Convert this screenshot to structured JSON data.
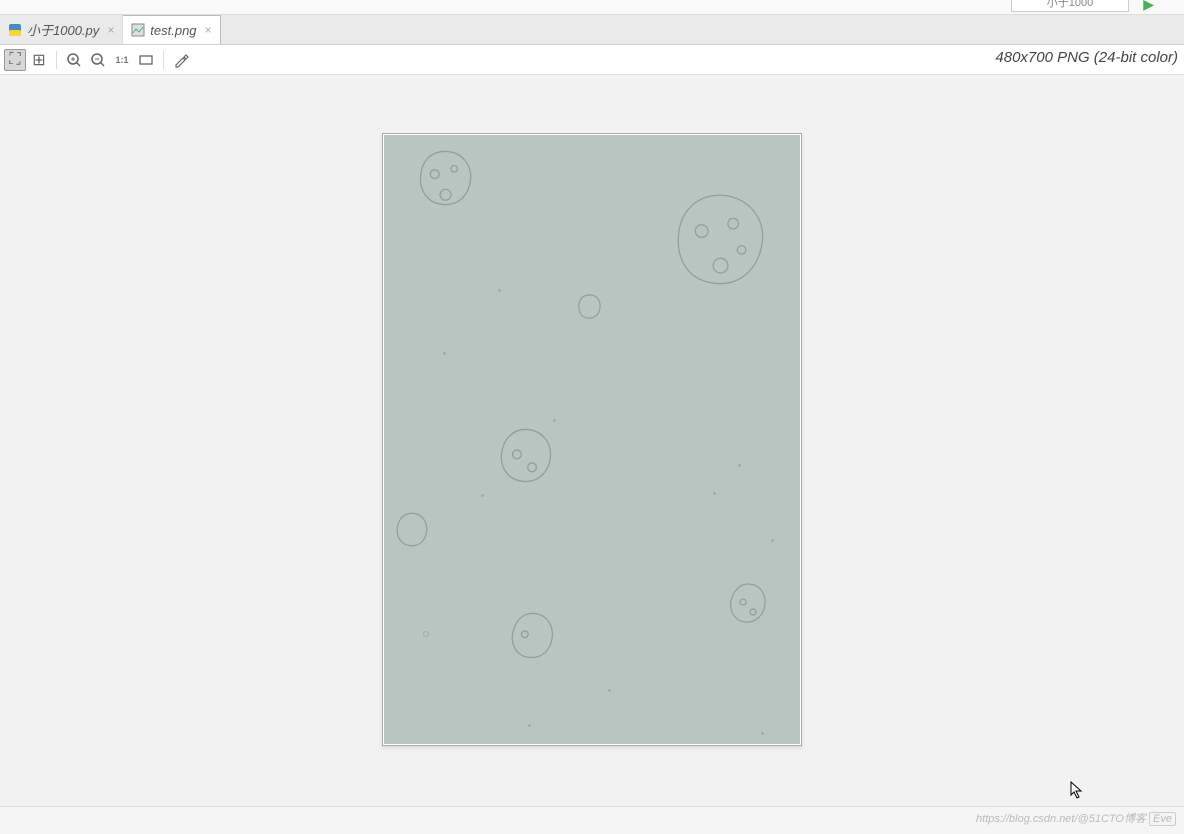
{
  "tabs": [
    {
      "label": "小于1000.py",
      "icon": "python-file-icon",
      "active": false
    },
    {
      "label": "test.png",
      "icon": "image-file-icon",
      "active": true
    }
  ],
  "toolbar": {
    "items": [
      {
        "name": "fullscreen-icon",
        "glyph": "⛶",
        "active": true
      },
      {
        "name": "grid-icon",
        "glyph": "⊞",
        "active": false
      },
      {
        "name": "sep"
      },
      {
        "name": "zoom-in-icon",
        "glyph": "⊕",
        "active": false
      },
      {
        "name": "zoom-out-icon",
        "glyph": "⊖",
        "active": false
      },
      {
        "name": "zoom-actual-icon",
        "glyph": "1:1",
        "active": false
      },
      {
        "name": "fit-window-icon",
        "glyph": "▭",
        "active": false
      },
      {
        "name": "sep"
      },
      {
        "name": "color-picker-icon",
        "glyph": "✎",
        "active": false
      }
    ]
  },
  "image_info": "480x700 PNG (24-bit color)",
  "top_widget_text": "小于1000",
  "watermark": "https://blog.csdn.net/@51CTO博客",
  "status_event": "Eve"
}
